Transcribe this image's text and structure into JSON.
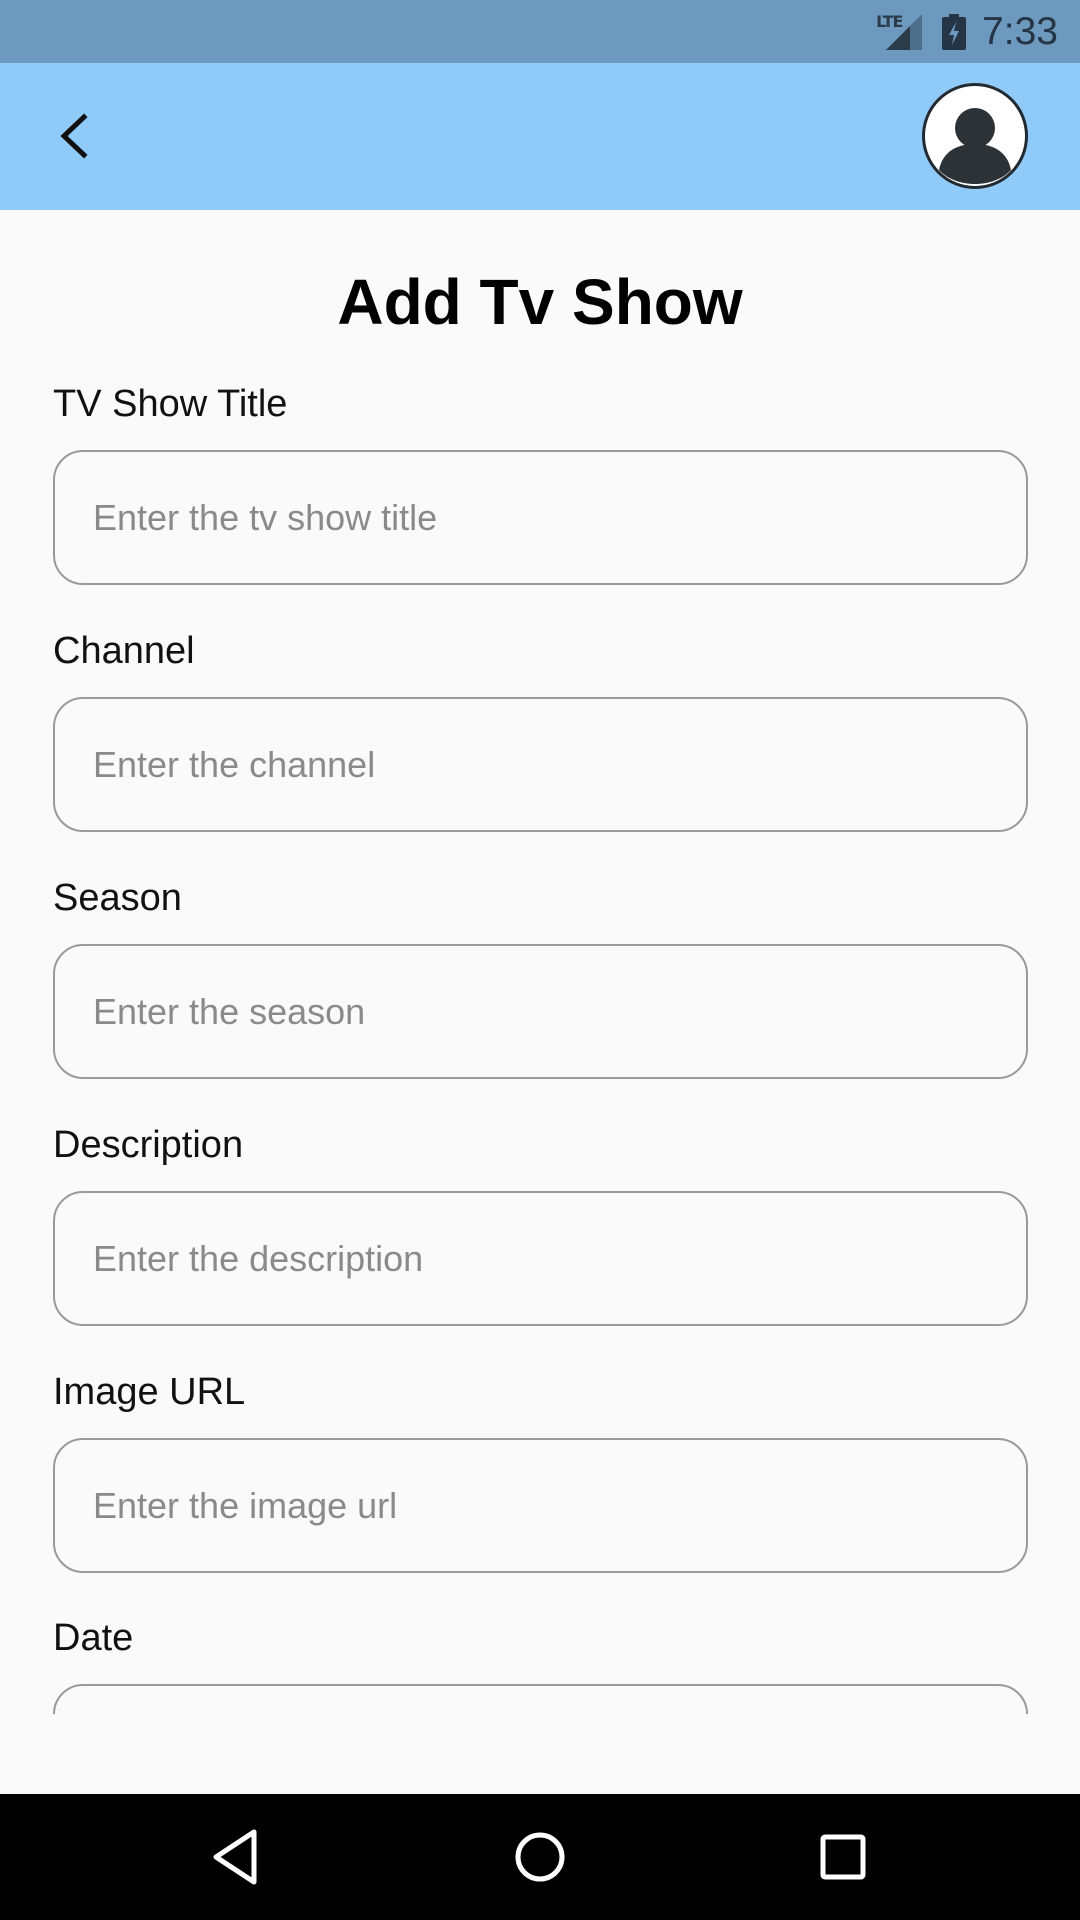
{
  "status_bar": {
    "network": "LTE",
    "time": "7:33"
  },
  "app_bar": {
    "back_icon": "chevron-left-icon",
    "avatar_icon": "account-circle-icon",
    "color": "#90caf9"
  },
  "page": {
    "title": "Add Tv Show"
  },
  "form": {
    "fields": [
      {
        "label": "TV Show Title",
        "placeholder": "Enter the tv show title",
        "value": ""
      },
      {
        "label": "Channel",
        "placeholder": "Enter the channel",
        "value": ""
      },
      {
        "label": "Season",
        "placeholder": "Enter the season",
        "value": ""
      },
      {
        "label": "Description",
        "placeholder": "Enter the description",
        "value": ""
      },
      {
        "label": "Image URL",
        "placeholder": "Enter the image url",
        "value": ""
      },
      {
        "label": "Date",
        "placeholder": "",
        "value": ""
      }
    ]
  },
  "nav_bar": {
    "back_icon": "triangle-back-icon",
    "home_icon": "circle-home-icon",
    "recents_icon": "square-recents-icon"
  }
}
